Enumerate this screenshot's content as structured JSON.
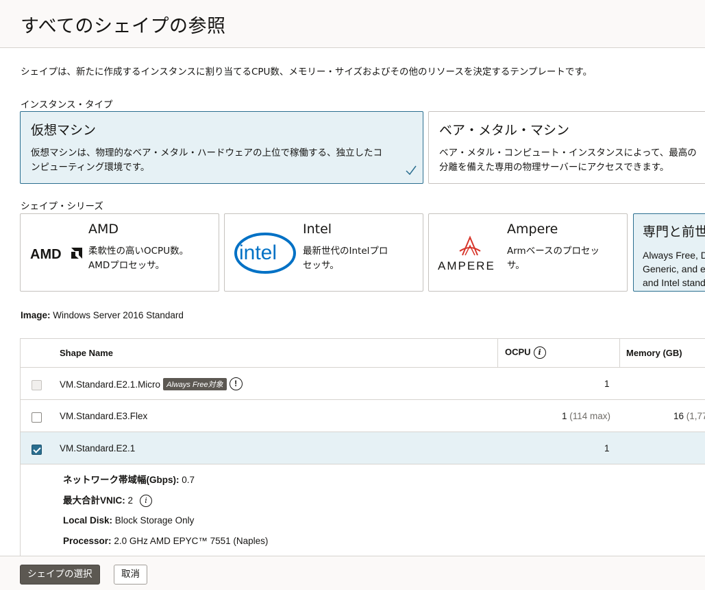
{
  "header": {
    "title": "すべてのシェイプの参照"
  },
  "intro": "シェイプは、新たに作成するインスタンスに割り当てるCPU数、メモリー・サイズおよびその他のリソースを決定するテンプレートです。",
  "instance_type": {
    "label": "インスタンス・タイプ",
    "cards": [
      {
        "title": "仮想マシン",
        "desc1": "仮想マシンは、物理的なベア・メタル・ハードウェアの上位で稼働する、独立したコ",
        "desc2": "ンピューティング環境です。",
        "selected": true
      },
      {
        "title": "ベア・メタル・マシン",
        "desc1": "ベア・メタル・コンピュート・インスタンスによって、最高の",
        "desc2": "分離を備えた専用の物理サーバーにアクセスできます。",
        "selected": false
      }
    ]
  },
  "shape_series": {
    "label": "シェイプ・シリーズ",
    "cards": [
      {
        "title": "AMD",
        "desc1": "柔軟性の高いOCPU数。",
        "desc2": "AMDプロセッサ。",
        "logo": "amd-logo",
        "logo_text": "AMD"
      },
      {
        "title": "Intel",
        "desc1": "最新世代のIntelプロ",
        "desc2": "セッサ。",
        "logo": "intel-logo",
        "logo_text": "intel"
      },
      {
        "title": "Ampere",
        "desc1": "Armベースのプロセッ",
        "desc2": "サ。",
        "logo": "ampere-logo",
        "logo_text": "AMPERE"
      },
      {
        "title": "専門と前世",
        "desc1": "Always Free, D",
        "desc2": "Generic, and e",
        "desc3": "and Intel stand",
        "selected": true
      }
    ]
  },
  "image": {
    "label": "Image:",
    "value": "Windows Server 2016 Standard"
  },
  "table": {
    "headers": {
      "name": "Shape Name",
      "ocpu": "OCPU",
      "memory": "Memory (GB)"
    },
    "rows": [
      {
        "name": "VM.Standard.E2.1.Micro",
        "badge": "Always Free対象",
        "ocpu": "1",
        "ocpu_extra": "",
        "memory": "",
        "memory_extra": "",
        "state": "disabled"
      },
      {
        "name": "VM.Standard.E3.Flex",
        "badge": "",
        "ocpu": "1",
        "ocpu_extra": "(114 max)",
        "memory": "16",
        "memory_extra": "(1,77",
        "state": "unchecked"
      },
      {
        "name": "VM.Standard.E2.1",
        "badge": "",
        "ocpu": "1",
        "ocpu_extra": "",
        "memory": "",
        "memory_extra": "",
        "state": "checked"
      }
    ],
    "details": [
      {
        "label": "ネットワーク帯域幅(Gbps):",
        "value": "0.7"
      },
      {
        "label": "最大合計VNIC:",
        "value": "2"
      },
      {
        "label": "Local Disk:",
        "value": "Block Storage Only"
      },
      {
        "label": "Processor:",
        "value": "2.0 GHz AMD EPYC™ 7551 (Naples)"
      }
    ]
  },
  "footer": {
    "select_label": "シェイプの選択",
    "cancel_label": "取消"
  },
  "colors": {
    "accent": "#2a6e8f",
    "selected_bg": "#e6f1f5",
    "primary_button": "#5c5852",
    "intel_blue": "#0071c5",
    "ampere_red": "#d7352a"
  }
}
